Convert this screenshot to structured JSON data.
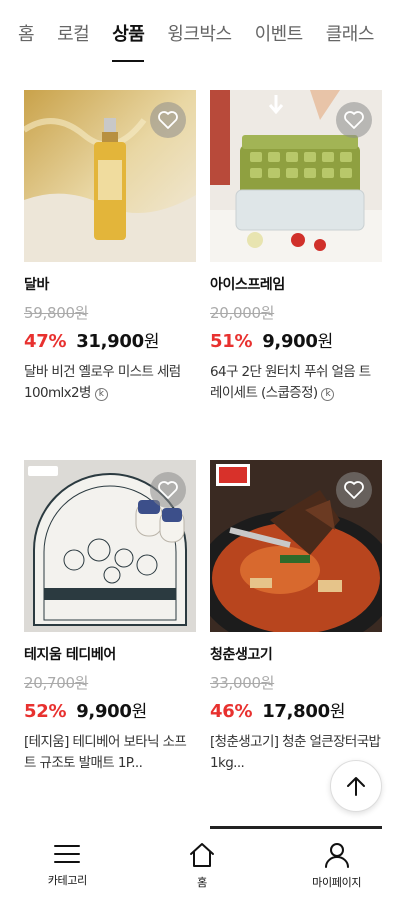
{
  "tabs": [
    "홈",
    "로컬",
    "상품",
    "윙크박스",
    "이벤트",
    "클래스"
  ],
  "active_tab": "상품",
  "products": [
    {
      "brand": "달바",
      "original_price": "59,800원",
      "discount": "47%",
      "price": "31,900",
      "currency": "원",
      "desc": "달바 비건 옐로우 미스트 세럼 100mlx2병",
      "has_k_badge": true,
      "k_badge": "k"
    },
    {
      "brand": "아이스프레임",
      "original_price": "20,000원",
      "discount": "51%",
      "price": "9,900",
      "currency": "원",
      "desc": "64구 2단 원터치 푸쉬 얼음 트레이세트 (스쿱증정)",
      "has_k_badge": true,
      "k_badge": "k"
    },
    {
      "brand": "테지움 테디베어",
      "original_price": "20,700원",
      "discount": "52%",
      "price": "9,900",
      "currency": "원",
      "desc": "[테지움] 테디베어 보타닉 소프트 규조토 발매트 1P...",
      "has_k_badge": false,
      "k_badge": ""
    },
    {
      "brand": "청춘생고기",
      "original_price": "33,000원",
      "discount": "46%",
      "price": "17,800",
      "currency": "원",
      "desc": "[청춘생고기] 청춘 얼큰장터국밥 1kg...",
      "has_k_badge": false,
      "k_badge": ""
    }
  ],
  "bottom_nav": [
    {
      "label": "카테고리",
      "icon": "menu-icon"
    },
    {
      "label": "홈",
      "icon": "home-icon"
    },
    {
      "label": "마이페이지",
      "icon": "user-icon"
    }
  ],
  "colors": {
    "discount": "#e8312f",
    "text": "#111111",
    "muted": "#aaaaaa"
  }
}
